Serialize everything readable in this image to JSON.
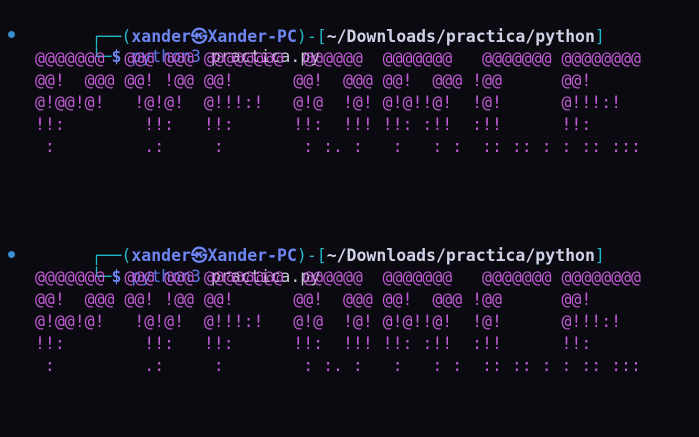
{
  "prompt": {
    "corner_top": "┌──",
    "corner_bottom": "└─",
    "open_paren": "(",
    "user": "xander",
    "at_symbol": "㉿",
    "host": "Xander-PC",
    "close_paren": ")",
    "dash": "-",
    "open_bracket": "[",
    "path": "~/Downloads/practica/python",
    "close_bracket": "]",
    "dollar": "$"
  },
  "commands": [
    {
      "program": "python3",
      "argument": "practica.py",
      "output": [
        "@@@@@@@  @@@ @@@ @@@@@@@@  @@@@@@  @@@@@@@   @@@@@@@ @@@@@@@@",
        "@@!  @@@ @@! !@@ @@!      @@!  @@@ @@!  @@@ !@@      @@!     ",
        "@!@@!@!   !@!@!  @!!!:!   @!@  !@! @!@!!@!  !@!      @!!!:!  ",
        "!!:        !!:   !!:      !!:  !!! !!: :!!  :!!      !!:     ",
        " :         .:     :        : :. :   :   : :  :: :: : : :: :::"
      ]
    },
    {
      "program": "python3",
      "argument": "practica.py",
      "output": [
        "@@@@@@@  @@@ @@@ @@@@@@@@  @@@@@@  @@@@@@@   @@@@@@@ @@@@@@@@",
        "@@!  @@@ @@! !@@ @@!      @@!  @@@ @@!  @@@ !@@      @@!     ",
        "@!@@!@!   !@!@!  @!!!:!   @!@  !@! @!@!!@!  !@!      @!!!:!  ",
        "!!:        !!:   !!:      !!:  !!! !!: :!!  :!!      !!:     ",
        " :         .:     :        : :. :   :   : :  :: :: : : :: :::"
      ]
    }
  ],
  "colors": {
    "background": "#0b0a10",
    "prompt_frame": "#22b8c8",
    "user_host": "#6d86f2",
    "path": "#cfd2e6",
    "command": "#5b74e8",
    "ascii_art": "#c25cd6",
    "status_dot": "#3a8fd0"
  }
}
